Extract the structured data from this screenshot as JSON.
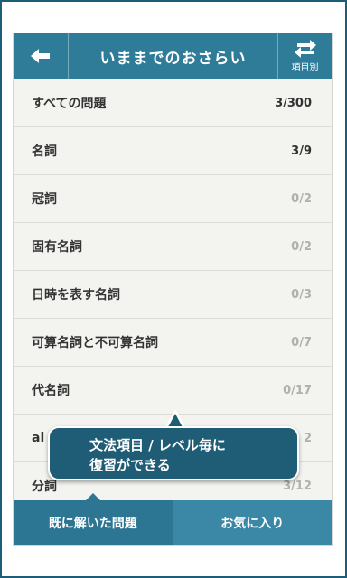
{
  "header": {
    "title": "いままでのおさらい",
    "back_icon": "arrow-left-icon",
    "sort_icon": "swap-arrows-icon",
    "sort_label": "項目別"
  },
  "rows": [
    {
      "label": "すべての問題",
      "count": "3/300",
      "done": true
    },
    {
      "label": "名詞",
      "count": "3/9",
      "done": true
    },
    {
      "label": "冠詞",
      "count": "0/2",
      "done": false
    },
    {
      "label": "固有名詞",
      "count": "0/2",
      "done": false
    },
    {
      "label": "日時を表す名詞",
      "count": "0/3",
      "done": false
    },
    {
      "label": "可算名詞と不可算名詞",
      "count": "0/7",
      "done": false
    },
    {
      "label": "代名詞",
      "count": "0/17",
      "done": false
    },
    {
      "label": "al",
      "count": "2",
      "done": false
    },
    {
      "label": "分詞",
      "count": "3/12",
      "done": false
    }
  ],
  "tabs": [
    {
      "label": "既に解いた問題",
      "active": true
    },
    {
      "label": "お気に入り",
      "active": false
    }
  ],
  "callout": {
    "line1": "文法項目 / レベル毎に",
    "line2": "復習ができる"
  },
  "colors": {
    "header": "#2f7c99",
    "tab_active": "#2c7593",
    "tab": "#3a88a6",
    "callout": "#1f5c75",
    "frame": "#1e5d78"
  }
}
